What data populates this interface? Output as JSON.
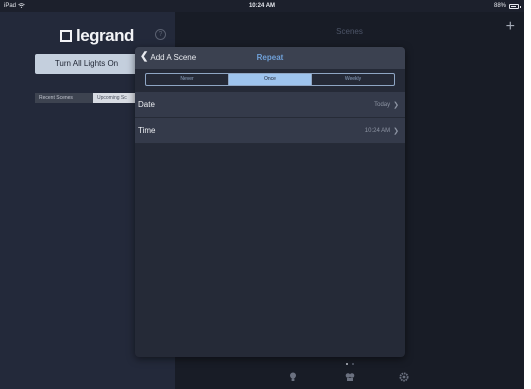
{
  "status_bar": {
    "device": "iPad",
    "time": "10:24 AM",
    "battery": "88%",
    "battery_level": 0.88,
    "icons": [
      "wifi-icon",
      "battery-icon"
    ]
  },
  "sidebar": {
    "brand": "legrand",
    "all_lights_button": "Turn All Lights On",
    "tabs": [
      {
        "label": "Recent Scenes",
        "active": true
      },
      {
        "label": "Upcoming Sc",
        "active": false
      }
    ]
  },
  "main": {
    "title": "Scenes",
    "add_icon": "plus-icon",
    "page_dots": 2,
    "bottom_icons": [
      "bulb-icon",
      "scene-icon",
      "gear-icon"
    ]
  },
  "modal": {
    "back_label": "Add A Scene",
    "title": "Repeat",
    "segments": [
      {
        "label": "Never",
        "selected": false
      },
      {
        "label": "Once",
        "selected": true
      },
      {
        "label": "Weekly",
        "selected": false
      }
    ],
    "rows": [
      {
        "label": "Date",
        "value": "Today"
      },
      {
        "label": "Time",
        "value": "10:24 AM"
      }
    ]
  },
  "colors": {
    "accent": "#9ec4ee",
    "title_blue": "#6fa0d8",
    "background": "#1c202c"
  }
}
